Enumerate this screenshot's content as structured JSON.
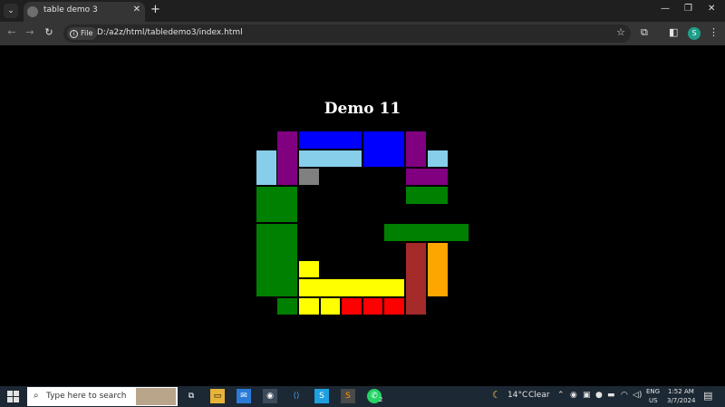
{
  "browser": {
    "tab_title": "table demo 3",
    "url_scheme_label": "File",
    "url": "D:/a2z/html/tabledemo3/index.html",
    "profile_initial": "S"
  },
  "page": {
    "heading": "Demo 11",
    "colors": {
      "purple": "#800080",
      "blue": "#0000ff",
      "lightblue": "#87ceeb",
      "gray": "#808080",
      "green": "#008000",
      "yellow": "#ffff00",
      "red": "#ff0000",
      "brown": "#a52a2a",
      "orange": "#ffa500"
    },
    "blocks": [
      {
        "name": "block-purple-top-left",
        "color": "purple"
      },
      {
        "name": "block-blue-top-wide",
        "color": "blue"
      },
      {
        "name": "block-blue-top-tall",
        "color": "blue"
      },
      {
        "name": "block-purple-top-right",
        "color": "purple"
      },
      {
        "name": "block-lightblue-left",
        "color": "lightblue"
      },
      {
        "name": "block-lightblue-wide",
        "color": "lightblue"
      },
      {
        "name": "block-lightblue-right",
        "color": "lightblue"
      },
      {
        "name": "block-gray",
        "color": "gray"
      },
      {
        "name": "block-purple-right-wide",
        "color": "purple"
      },
      {
        "name": "block-green-left-upper",
        "color": "green"
      },
      {
        "name": "block-green-right-small",
        "color": "green"
      },
      {
        "name": "block-green-right-bar",
        "color": "green"
      },
      {
        "name": "block-green-left-lower",
        "color": "green"
      },
      {
        "name": "block-yellow-small",
        "color": "yellow"
      },
      {
        "name": "block-brown-tall",
        "color": "brown"
      },
      {
        "name": "block-orange-tall",
        "color": "orange"
      },
      {
        "name": "block-yellow-wide",
        "color": "yellow"
      },
      {
        "name": "block-green-bottom",
        "color": "green"
      },
      {
        "name": "block-yellow-bottom-1",
        "color": "yellow"
      },
      {
        "name": "block-yellow-bottom-2",
        "color": "yellow"
      },
      {
        "name": "block-red-bottom-1",
        "color": "red"
      },
      {
        "name": "block-red-bottom-2",
        "color": "red"
      },
      {
        "name": "block-red-bottom-3",
        "color": "red"
      }
    ]
  },
  "taskbar": {
    "search_placeholder": "Type here to search",
    "weather_temp": "14°C",
    "weather_text": "Clear",
    "lang_1": "ENG",
    "lang_2": "US",
    "time": "1:52 AM",
    "date": "3/7/2024",
    "notification_count": "2"
  }
}
